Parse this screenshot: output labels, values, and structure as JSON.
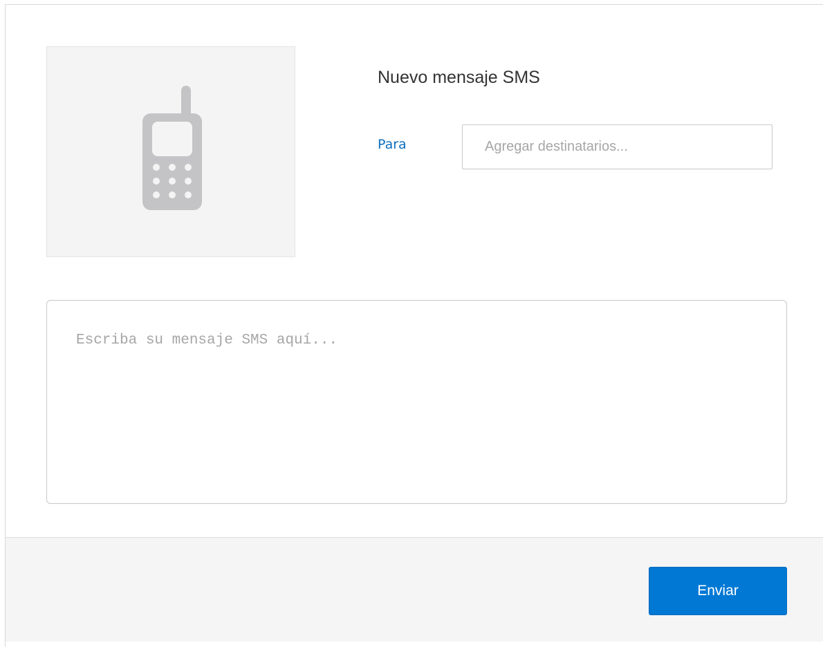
{
  "dialog": {
    "title": "Nuevo mensaje SMS",
    "avatar_icon": "mobile-phone-icon",
    "to_label": "Para",
    "recipients": {
      "value": "",
      "placeholder": "Agregar destinatarios..."
    },
    "message": {
      "value": "",
      "placeholder": "Escriba su mensaje SMS aquí..."
    },
    "send_label": "Enviar"
  },
  "colors": {
    "accent": "#0078d4",
    "link": "#0e6fbf",
    "icon_gray": "#c4c4c6"
  }
}
